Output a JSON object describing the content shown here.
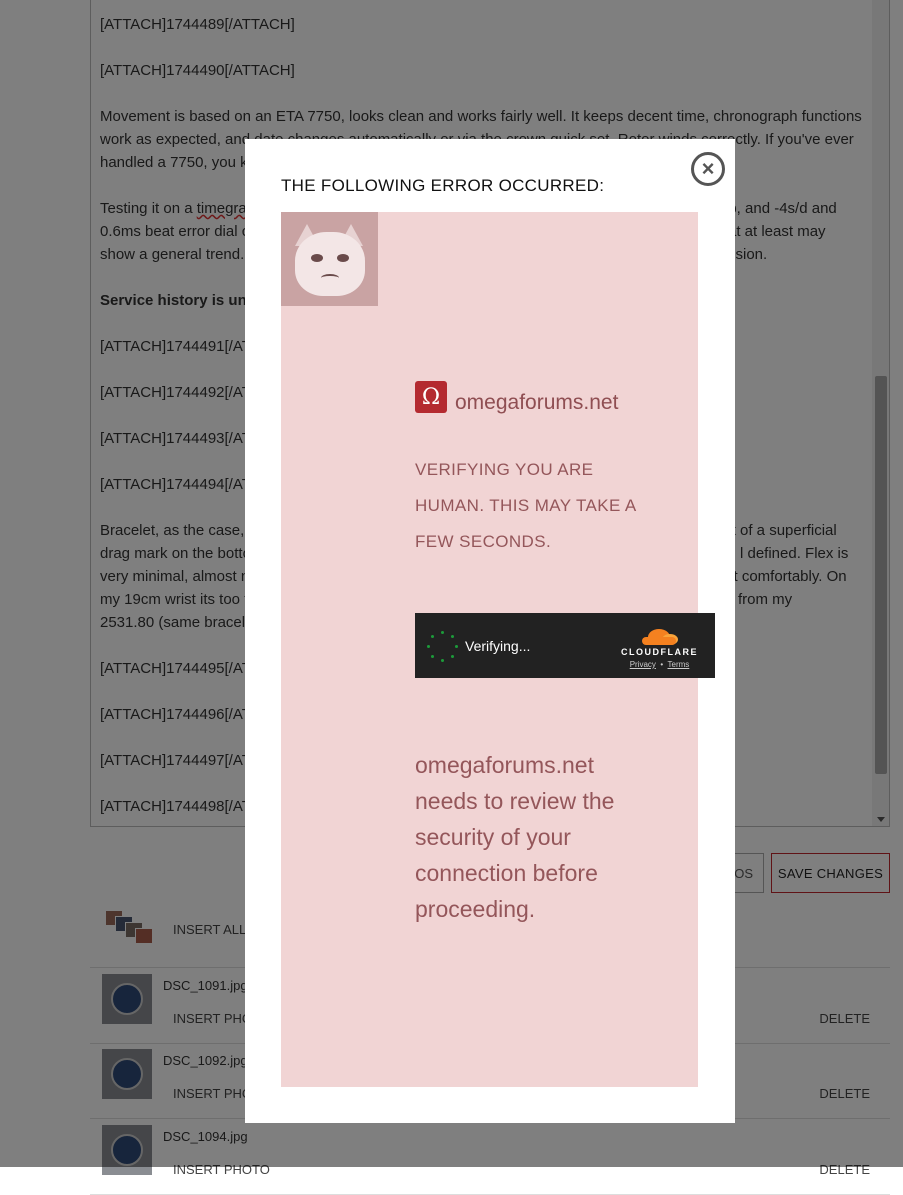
{
  "editor": {
    "paragraphs": [
      {
        "text": "[ATTACH]1744489[/ATTACH]",
        "bold": false
      },
      {
        "text": "[ATTACH]1744490[/ATTACH]",
        "bold": false
      },
      {
        "text": "Movement is based on an ETA 7750, looks clean and works fairly well. It keeps decent time, chronograph functions work as expected, and date changes automatically or via the crown quick set. Rotor winds correctly. If you've ever handled a 7750, you k",
        "bold": false
      },
      {
        "text_pre": "Testing it on a ",
        "text_spell": "timegra",
        "text_post": "",
        "right_fragment": "up, and -4s/d and",
        "line2": "0.6ms beat error dial c",
        "line2_right": "at at least may",
        "line3": "show a general trend.",
        "line3_right": "ssion."
      },
      {
        "text": "Service history is un",
        "bold": true
      },
      {
        "text": "[ATTACH]1744491[/AT",
        "bold": false
      },
      {
        "text": "[ATTACH]1744492[/AT",
        "bold": false
      },
      {
        "text": "[ATTACH]1744493[/AT",
        "bold": false
      },
      {
        "text": "[ATTACH]1744494[/AT",
        "bold": false
      },
      {
        "line1": "Bracelet, as the case,",
        "line1_right": "bit of a superficial",
        "line2": "drag mark on the botto",
        "line2_right": "l defined. Flex is",
        "line3": "very minimal, almost n",
        "line3_right": "st comfortably. On",
        "line4": "my 19cm wrist its too t",
        "line4_right": "nk from my",
        "line5": "2531.80 (same bracele"
      },
      {
        "text": "[ATTACH]1744495[/AT",
        "bold": false
      },
      {
        "text": "[ATTACH]1744496[/AT",
        "bold": false
      },
      {
        "text": "[ATTACH]1744497[/AT",
        "bold": false
      },
      {
        "text": "[ATTACH]1744498[/AT",
        "bold": false
      }
    ]
  },
  "actions": {
    "photos_label": "OS",
    "save_label": "SAVE CHANGES"
  },
  "attachments": {
    "insert_all_label": "INSERT ALL",
    "items": [
      {
        "filename": "DSC_1091.jpg",
        "insert_label": "INSERT PHO",
        "delete_label": "DELETE"
      },
      {
        "filename": "DSC_1092.jpg",
        "insert_label": "INSERT PHO",
        "delete_label": "DELETE"
      },
      {
        "filename": "DSC_1094.jpg",
        "insert_label": "INSERT PHOTO",
        "delete_label": "DELETE"
      }
    ]
  },
  "modal": {
    "title": "THE FOLLOWING ERROR OCCURRED:",
    "close_glyph": "×",
    "brand_glyph": "Ω",
    "brand_name": "omegaforums.net",
    "verify_heading": "VERIFYING YOU ARE HUMAN. THIS MAY TAKE A FEW SECONDS.",
    "widget": {
      "status": "Verifying...",
      "provider": "CLOUDFLARE",
      "privacy": "Privacy",
      "separator": "•",
      "terms": "Terms"
    },
    "review_text": "omegaforums.net needs to review the security of your connection before proceeding."
  },
  "colors": {
    "accent": "#c0262d",
    "panel_bg": "#f1d4d4",
    "panel_text": "#94565a",
    "cloudflare_orange": "#f48120"
  }
}
